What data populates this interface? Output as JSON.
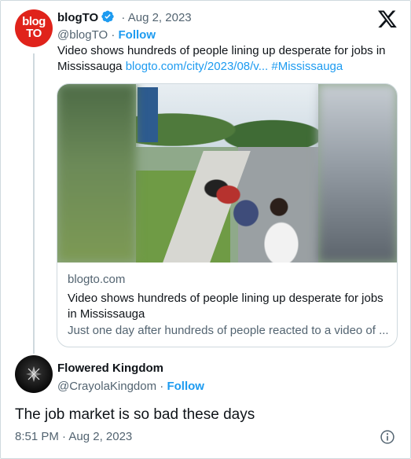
{
  "original_tweet": {
    "author_name": "blogTO",
    "avatar_text_line1": "blog",
    "avatar_text_line2": "TO",
    "handle": "@blogTO",
    "date": "Aug 2, 2023",
    "date_sep": "·",
    "follow_label": "Follow",
    "text_plain": "Video shows hundreds of people lining up desperate for jobs in Mississauga",
    "link_text": "blogto.com/city/2023/08/v...",
    "hashtag": "#Mississauga",
    "icons": {
      "verified": "verified-badge-icon",
      "platform": "x-logo-icon"
    },
    "link_card": {
      "domain": "blogto.com",
      "title": "Video shows hundreds of people lining up desperate for jobs in Mississauga",
      "description": "Just one day after hundreds of people reacted to a video of ..."
    }
  },
  "reply": {
    "author_name": "Flowered Kingdom",
    "handle": "@CrayolaKingdom",
    "sep": "·",
    "follow_label": "Follow",
    "text": "The job market is so bad these days",
    "timestamp": "8:51 PM · Aug 2, 2023",
    "icons": {
      "info": "info-icon"
    }
  },
  "colors": {
    "accent": "#1d9bf0",
    "brand_red": "#e0231b",
    "text": "#0f1419",
    "muted": "#536471",
    "border": "#cfd9de"
  }
}
